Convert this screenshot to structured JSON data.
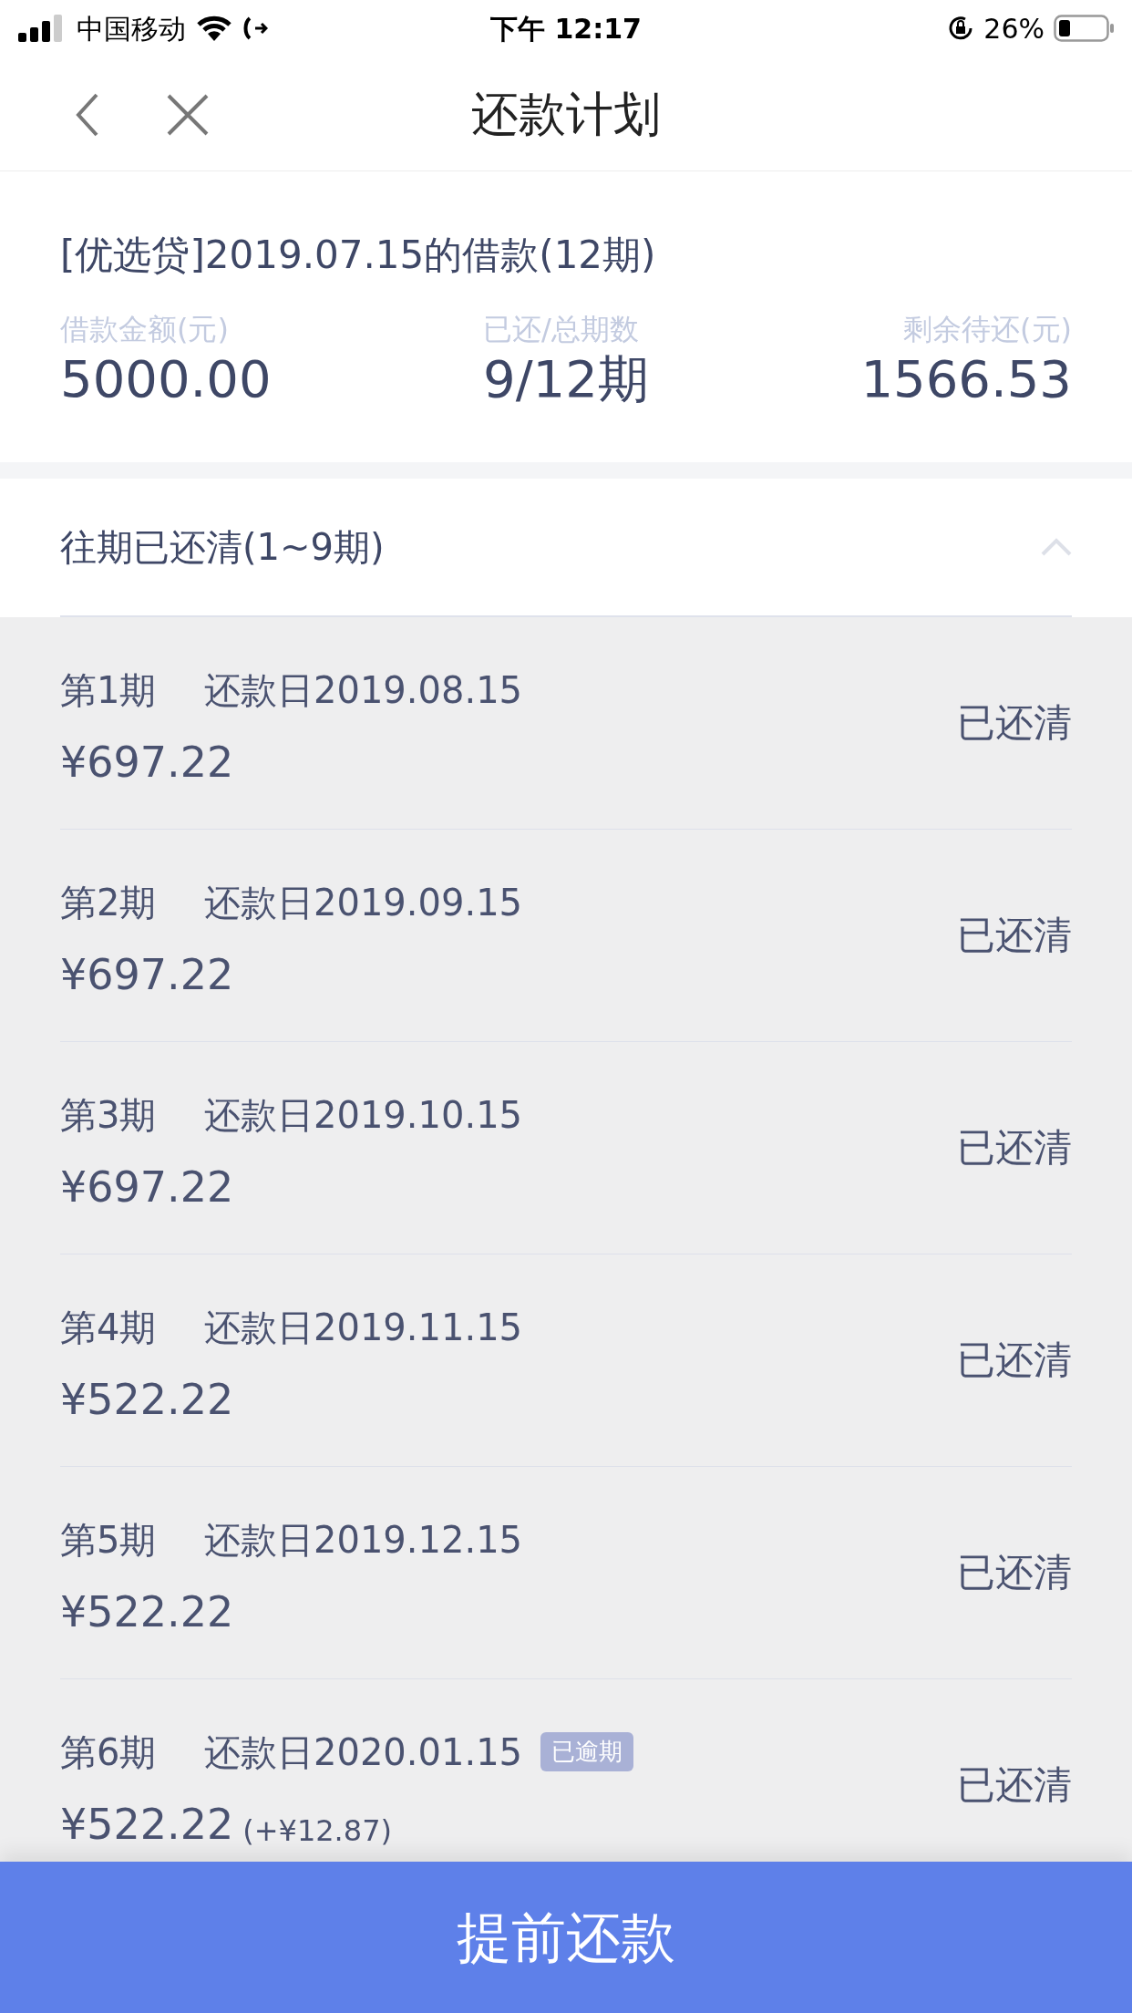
{
  "status_bar": {
    "carrier": "中国移动",
    "time": "下午 12:17",
    "battery": "26%"
  },
  "nav": {
    "title": "还款计划"
  },
  "loan": {
    "title": "[优选贷]2019.07.15的借款(12期)",
    "stats": [
      {
        "label": "借款金额(元)",
        "value": "5000.00"
      },
      {
        "label": "已还/总期数",
        "value": "9/12期"
      },
      {
        "label": "剩余待还(元)",
        "value": "1566.53"
      }
    ]
  },
  "history": {
    "title": "往期已还清(1~9期)",
    "expanded": true,
    "rows": [
      {
        "period": "第1期",
        "date": "还款日2019.08.15",
        "amount": "¥697.22",
        "status": "已还清"
      },
      {
        "period": "第2期",
        "date": "还款日2019.09.15",
        "amount": "¥697.22",
        "status": "已还清"
      },
      {
        "period": "第3期",
        "date": "还款日2019.10.15",
        "amount": "¥697.22",
        "status": "已还清"
      },
      {
        "period": "第4期",
        "date": "还款日2019.11.15",
        "amount": "¥522.22",
        "status": "已还清"
      },
      {
        "period": "第5期",
        "date": "还款日2019.12.15",
        "amount": "¥522.22",
        "status": "已还清"
      },
      {
        "period": "第6期",
        "date": "还款日2020.01.15",
        "tag": "已逾期",
        "amount": "¥522.22",
        "extra": "(+¥12.87)",
        "status": "已还清"
      }
    ]
  },
  "action_button": "提前还款"
}
